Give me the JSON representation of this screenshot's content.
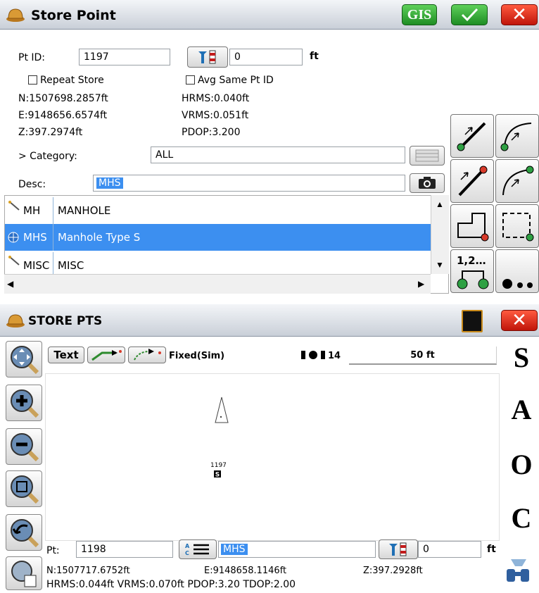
{
  "store_point": {
    "title": "Store Point",
    "gis_label": "GIS",
    "pt_id_label": "Pt ID:",
    "pt_id_value": "1197",
    "offset_value": "0",
    "offset_unit": "ft",
    "repeat_store_label": "Repeat Store",
    "avg_same_label": "Avg Same Pt ID",
    "north": "N:1507698.2857ft",
    "east": "E:9148656.6574ft",
    "elev": "Z:397.2974ft",
    "hrms": "HRMS:0.040ft",
    "vrms": "VRMS:0.051ft",
    "pdop": "PDOP:3.200",
    "category_label": "> Category:",
    "category_value": "ALL",
    "desc_label": "Desc:",
    "desc_value": "MHS",
    "codes": [
      {
        "code": "MH",
        "desc": "MANHOLE",
        "icon": "line-pen-icon",
        "selected": false
      },
      {
        "code": "MHS",
        "desc": "Manhole Type S",
        "icon": "globe-icon",
        "selected": true
      },
      {
        "code": "MISC",
        "desc": "MISC",
        "icon": "line-pen-icon",
        "selected": false
      }
    ]
  },
  "store_pts": {
    "title": "STORE PTS",
    "text_btn": "Text",
    "fix_status": "Fixed(Sim)",
    "satellites": "14",
    "scale": "50 ft",
    "map_point_label": "1197",
    "side_letters": [
      "S",
      "A",
      "O",
      "C"
    ],
    "pt_label": "Pt:",
    "pt_value": "1198",
    "desc_value": "MHS",
    "offset_value": "0",
    "offset_unit": "ft",
    "north": "N:1507717.6752ft",
    "east": "E:9148658.1146ft",
    "elev": "Z:397.2928ft",
    "quality": "HRMS:0.044ft VRMS:0.070ft PDOP:3.20 TDOP:2.00"
  },
  "colors": {
    "selection": "#3c8ff0",
    "ok_green": "#1e8d24",
    "close_red": "#c0150a"
  }
}
